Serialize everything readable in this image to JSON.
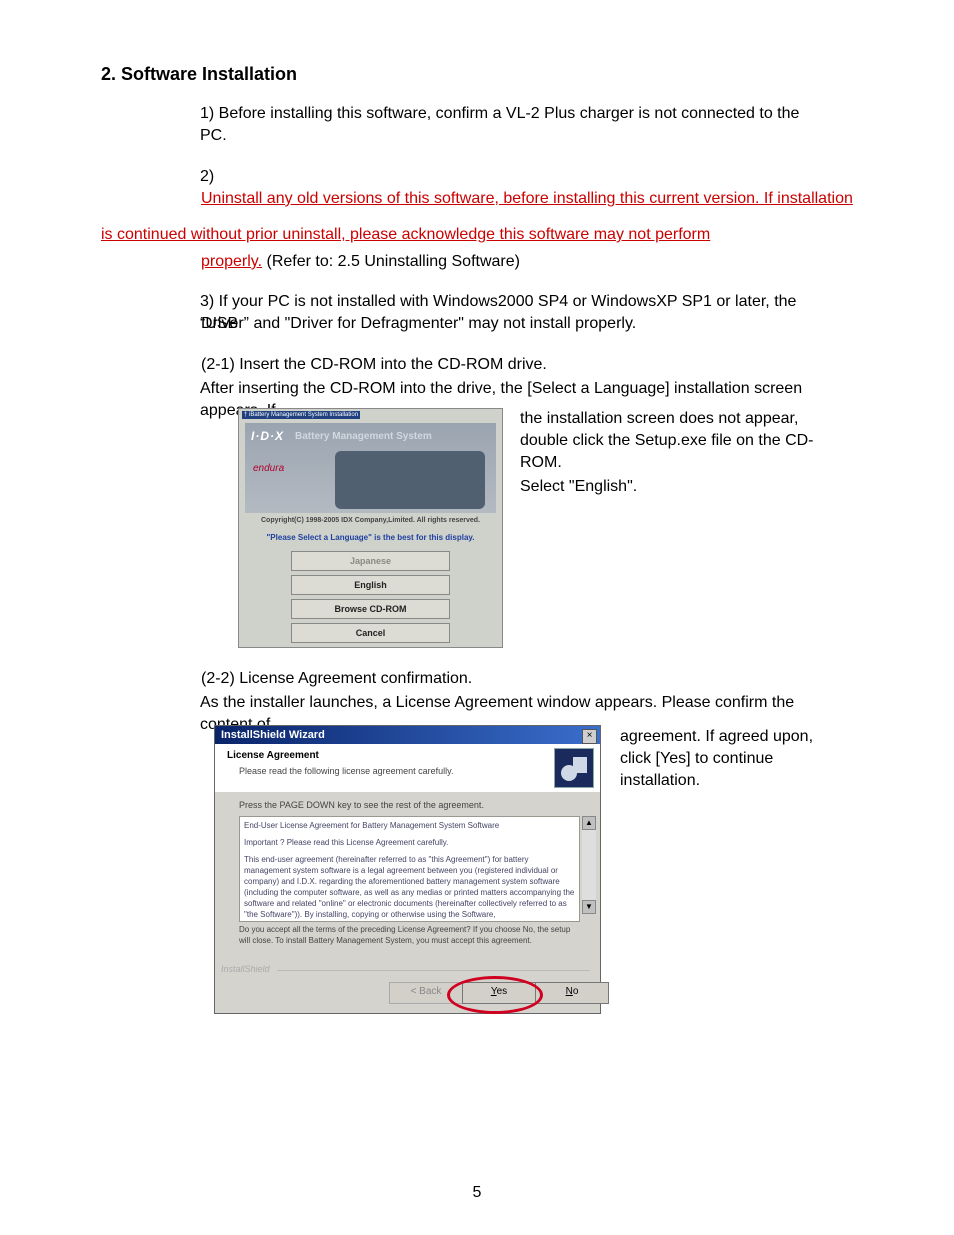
{
  "doc": {
    "header": "2. Software Installation",
    "par1": "1)  Before installing this software, confirm a VL-2 Plus charger is not connected to the PC.",
    "par2": "2)",
    "par2_ul1": "Uninstall any old versions of this software, before installing this current version. If installation",
    "par2_ul2": "is continued without prior uninstall, please acknowledge this software may not perform",
    "par2_ul3": "properly.",
    "par2_post": " (Refer to: 2.5 Uninstalling Software)",
    "par3a": "3)  If your PC is not installed with Windows2000 SP4 or WindowsXP SP1 or later, the “USB",
    "par3b": "Driver” and \"Driver for Defragmenter\" may not install properly.",
    "step2_1_h": "(2-1)  Insert the CD-ROM into the CD-ROM drive.",
    "step2_1_a": "After inserting the CD-ROM into the drive, the [Select a Language] installation screen appears. If",
    "step2_1_b": "the installation screen does not appear, double click the Setup.exe file on the CD-ROM.",
    "select_lang": "Select \"English\".",
    "step2_2_h": "(2-2)  License Agreement confirmation.",
    "step2_2_a": "As the installer launches, a License Agreement window appears. Please confirm the content of",
    "step2_2_b": "agreement. If agreed upon, click [Yes] to continue installation.",
    "page_num": "5"
  },
  "lang_window": {
    "title": "† iBattery Management System Installation",
    "logo": "I·D·X",
    "banner_text": "Battery Management System",
    "endura": "endura",
    "copyright": "Copyright(C) 1998-2005 IDX Company,Limited. All rights reserved.",
    "hint": "\"Please Select a Language\" is the best for this display.",
    "buttons": {
      "japanese": "Japanese",
      "english": "English",
      "browse": "Browse CD-ROM",
      "cancel": "Cancel"
    }
  },
  "is_window": {
    "title": "InstallShield Wizard",
    "header_bold": "License Agreement",
    "header_sub": "Please read the following license agreement carefully.",
    "press": "Press the PAGE DOWN key to see the rest of the agreement.",
    "body_l1": "End-User License Agreement for Battery Management System Software",
    "body_l2": "Important ? Please read this License Agreement carefully.",
    "body_l3": "This end-user agreement (hereinafter referred to as \"this Agreement\") for battery management system software is a legal agreement between you (registered individual or company) and I.D.X. regarding the aforementioned battery management system software (including the computer software, as well as any medias or printed matters accompanying the software and related \"online\" or electronic documents (hereinafter collectively referred to as \"the Software\")).  By installing, copying or otherwise using the Software,",
    "accept": "Do you accept all the terms of the preceding License Agreement?  If you choose No,  the setup will close.  To install Battery Management System, you must accept this agreement.",
    "brand": "InstallShield",
    "back": "< Back",
    "yes": "Yes",
    "no": "No"
  }
}
